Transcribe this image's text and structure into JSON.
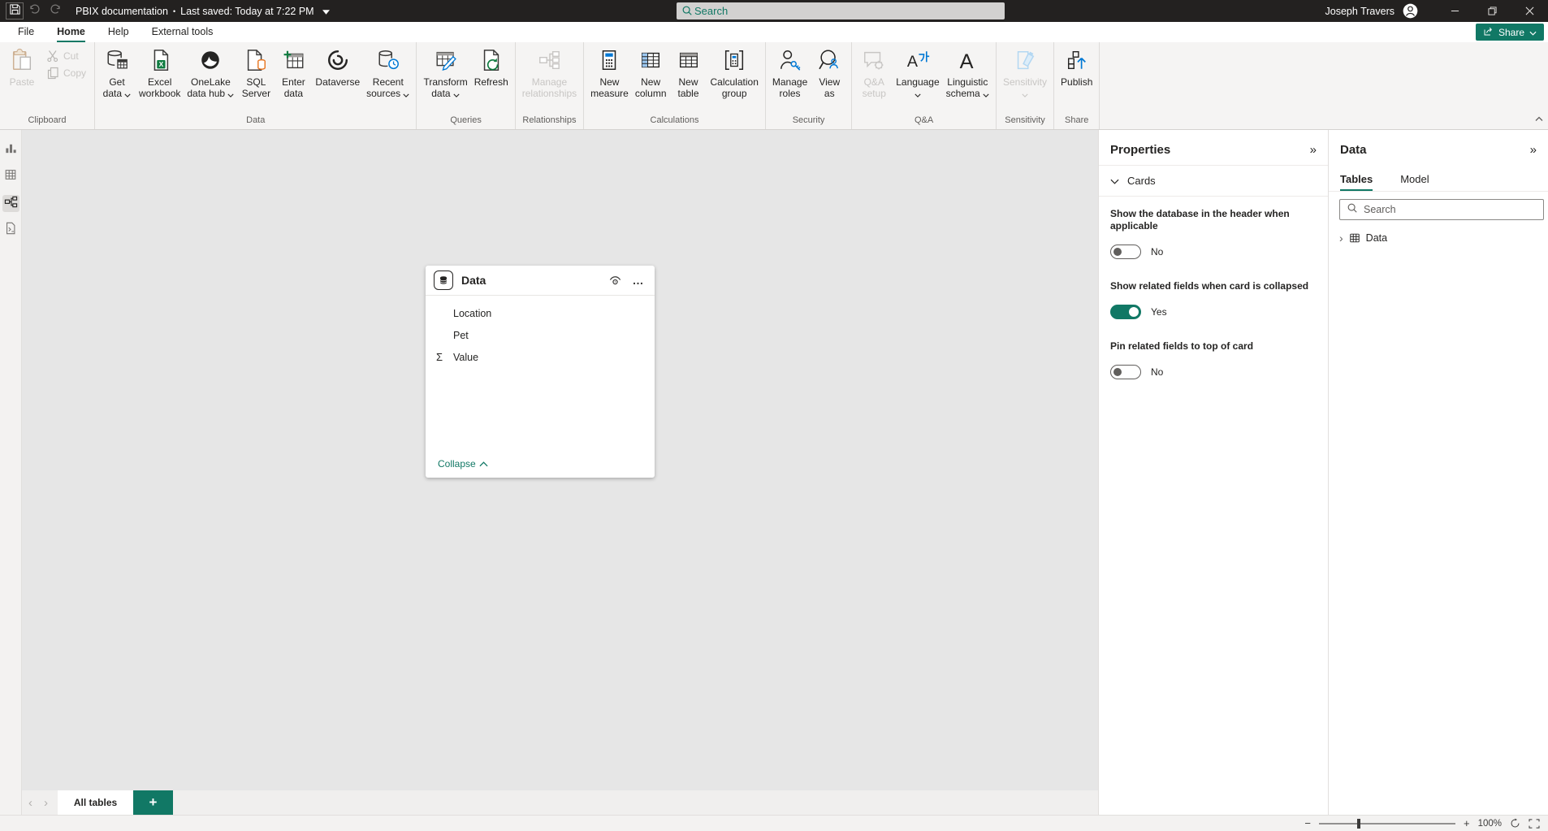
{
  "titlebar": {
    "title": "PBIX documentation",
    "separator": "•",
    "saved": "Last saved: Today at 7:22 PM",
    "search_placeholder": "Search",
    "user": "Joseph Travers"
  },
  "menu": {
    "items": [
      "File",
      "Home",
      "Help",
      "External tools"
    ],
    "active": "Home",
    "share_label": "Share"
  },
  "ribbon": {
    "groups": [
      {
        "label": "Clipboard",
        "buttons": [
          {
            "name": "paste",
            "lines": [
              "Paste"
            ],
            "icon": "paste",
            "disabled": true,
            "large": true
          },
          {
            "name": "cut",
            "lines": [
              "Cut"
            ],
            "icon": "cut",
            "disabled": true,
            "small": true
          },
          {
            "name": "copy",
            "lines": [
              "Copy"
            ],
            "icon": "copy",
            "disabled": true,
            "small": true
          }
        ]
      },
      {
        "label": "Data",
        "buttons": [
          {
            "name": "get-data",
            "lines": [
              "Get",
              "data"
            ],
            "icon": "getdata",
            "chevron": "inline"
          },
          {
            "name": "excel-workbook",
            "lines": [
              "Excel",
              "workbook"
            ],
            "icon": "excel"
          },
          {
            "name": "onelake-data-hub",
            "lines": [
              "OneLake",
              "data hub"
            ],
            "icon": "onelake",
            "chevron": "inline"
          },
          {
            "name": "sql-server",
            "lines": [
              "SQL",
              "Server"
            ],
            "icon": "sql"
          },
          {
            "name": "enter-data",
            "lines": [
              "Enter",
              "data"
            ],
            "icon": "enterdata"
          },
          {
            "name": "dataverse",
            "lines": [
              "Dataverse"
            ],
            "icon": "dataverse"
          },
          {
            "name": "recent-sources",
            "lines": [
              "Recent",
              "sources"
            ],
            "icon": "recent",
            "chevron": "inline"
          }
        ]
      },
      {
        "label": "Queries",
        "buttons": [
          {
            "name": "transform-data",
            "lines": [
              "Transform",
              "data"
            ],
            "icon": "transform",
            "chevron": "inline"
          },
          {
            "name": "refresh",
            "lines": [
              "Refresh"
            ],
            "icon": "refresh"
          }
        ]
      },
      {
        "label": "Relationships",
        "buttons": [
          {
            "name": "manage-relationships",
            "lines": [
              "Manage",
              "relationships"
            ],
            "icon": "relationships",
            "disabled": true
          }
        ]
      },
      {
        "label": "Calculations",
        "buttons": [
          {
            "name": "new-measure",
            "lines": [
              "New",
              "measure"
            ],
            "icon": "measure"
          },
          {
            "name": "new-column",
            "lines": [
              "New",
              "column"
            ],
            "icon": "newcol"
          },
          {
            "name": "new-table",
            "lines": [
              "New",
              "table"
            ],
            "icon": "newtable"
          },
          {
            "name": "calculation-group",
            "lines": [
              "Calculation",
              "group"
            ],
            "icon": "calcgroup"
          }
        ]
      },
      {
        "label": "Security",
        "buttons": [
          {
            "name": "manage-roles",
            "lines": [
              "Manage",
              "roles"
            ],
            "icon": "roles"
          },
          {
            "name": "view-as",
            "lines": [
              "View",
              "as"
            ],
            "icon": "viewas"
          }
        ]
      },
      {
        "label": "Q&A",
        "buttons": [
          {
            "name": "qa-setup",
            "lines": [
              "Q&A",
              "setup"
            ],
            "icon": "qa",
            "disabled": true
          },
          {
            "name": "language",
            "lines": [
              "Language"
            ],
            "icon": "language",
            "chevron": "below"
          },
          {
            "name": "linguistic-schema",
            "lines": [
              "Linguistic",
              "schema"
            ],
            "icon": "linguistic",
            "chevron": "inline"
          }
        ]
      },
      {
        "label": "Sensitivity",
        "buttons": [
          {
            "name": "sensitivity",
            "lines": [
              "Sensitivity"
            ],
            "icon": "sensitivity",
            "disabled": true,
            "chevron": "below"
          }
        ]
      },
      {
        "label": "Share",
        "buttons": [
          {
            "name": "publish",
            "lines": [
              "Publish"
            ],
            "icon": "publish"
          }
        ]
      }
    ]
  },
  "rail": {
    "items": [
      {
        "name": "report-view",
        "icon": "railreport",
        "active": false
      },
      {
        "name": "table-view",
        "icon": "railtable",
        "active": false
      },
      {
        "name": "model-view",
        "icon": "railmodel",
        "active": true
      },
      {
        "name": "dax-query-view",
        "icon": "raildax",
        "active": false
      }
    ]
  },
  "canvas": {
    "card": {
      "title": "Data",
      "fields": [
        {
          "label": "Location",
          "aggregate": false
        },
        {
          "label": "Pet",
          "aggregate": false
        },
        {
          "label": "Value",
          "aggregate": true
        }
      ],
      "sigma": "Σ",
      "collapse_label": "Collapse"
    },
    "tabs": {
      "all_tables_label": "All tables",
      "add_label": "+"
    }
  },
  "properties": {
    "title": "Properties",
    "section": "Cards",
    "settings": [
      {
        "label": "Show the database in the header when applicable",
        "state": "No",
        "on": false
      },
      {
        "label": "Show related fields when card is collapsed",
        "state": "Yes",
        "on": true
      },
      {
        "label": "Pin related fields to top of card",
        "state": "No",
        "on": false
      }
    ]
  },
  "data_panel": {
    "title": "Data",
    "tabs": [
      "Tables",
      "Model"
    ],
    "active_tab": "Tables",
    "search_placeholder": "Search",
    "items": [
      {
        "label": "Data"
      }
    ]
  },
  "statusbar": {
    "zoom_out": "−",
    "zoom_in": "+",
    "zoom_level": "100%"
  },
  "colors": {
    "accent_teal": "#117865",
    "titlebar_bg": "#232120",
    "canvas_bg": "#e6e6e6"
  }
}
